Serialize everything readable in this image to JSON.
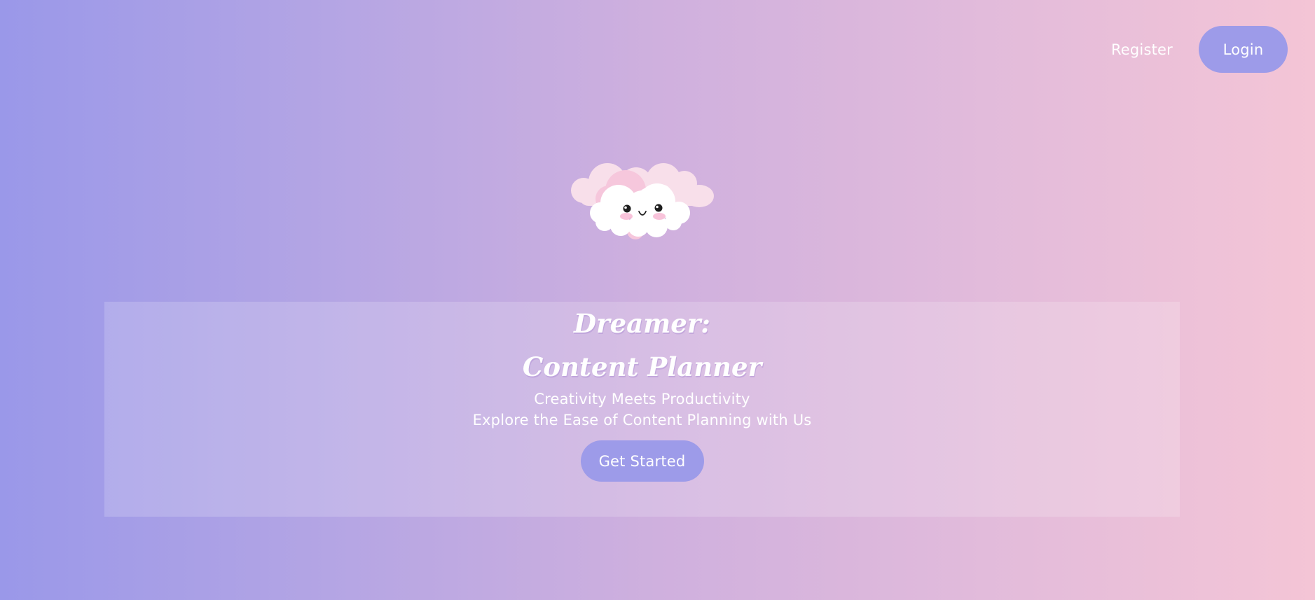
{
  "nav": {
    "register_label": "Register",
    "login_label": "Login"
  },
  "mascot": {
    "icon": "smiling-cloud-icon"
  },
  "hero": {
    "title_line1": "Dreamer:",
    "title_line2": "Content Planner",
    "tagline": "Creativity Meets Productivity",
    "subtitle": "Explore the Ease of Content Planning with Us",
    "cta_label": "Get Started"
  },
  "colors": {
    "gradient_start": "#9a98e9",
    "gradient_end": "#f4c5d6",
    "button": "#9d9be9",
    "text": "#ffffff"
  }
}
